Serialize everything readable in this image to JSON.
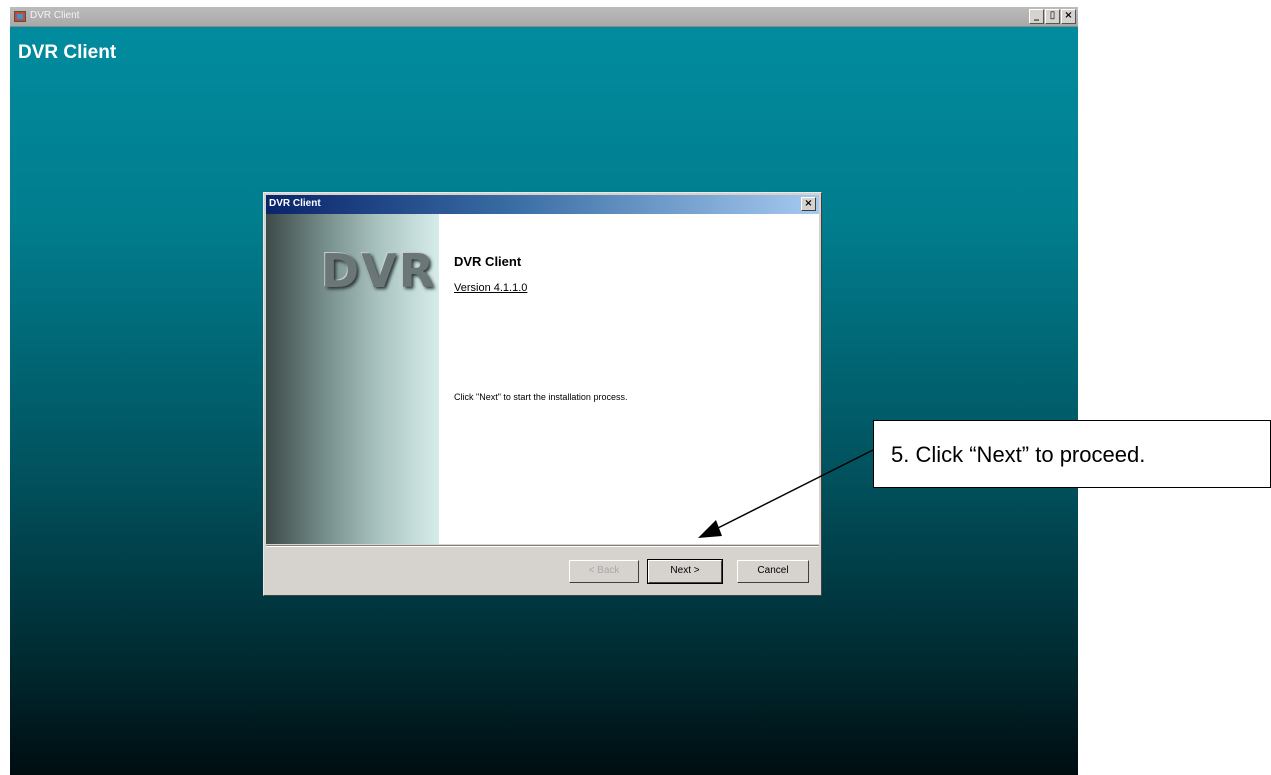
{
  "app_window": {
    "title": "DVR Client",
    "heading": "DVR Client",
    "minimize_glyph": "_",
    "maximize_glyph": "▯",
    "close_glyph": "×"
  },
  "dialog": {
    "title": "DVR Client",
    "close_glyph": "×",
    "banner_logo": "DVR",
    "product_name": "DVR Client",
    "version": "Version 4.1.1.0",
    "instruction": "Click \"Next\" to start the installation process.",
    "buttons": {
      "back": "< Back",
      "next": "Next >",
      "cancel": "Cancel"
    }
  },
  "callout": {
    "text": "5. Click “Next” to proceed."
  },
  "colors": {
    "background_top": "#018da0",
    "background_bottom": "#000d10",
    "dialog_titlebar": "#0a246a"
  }
}
